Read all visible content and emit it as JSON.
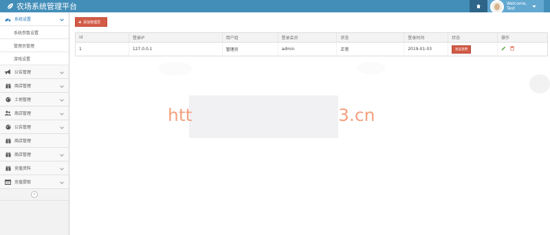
{
  "header": {
    "title": "农场系统管理平台",
    "welcome": "Welcome,",
    "username": "Test",
    "bg_color": "#438eb9"
  },
  "sidebar": {
    "items": [
      {
        "label": "系统设置",
        "icon": "dashboard-icon",
        "open": true,
        "sub": [
          {
            "label": "系统参数设置"
          },
          {
            "label": "管理员管理"
          },
          {
            "label": "游戏设置"
          }
        ]
      },
      {
        "label": "公告管理",
        "icon": "bullhorn-icon"
      },
      {
        "label": "商店管理",
        "icon": "gift-icon"
      },
      {
        "label": "土地管理",
        "icon": "globe-icon"
      },
      {
        "label": "商店管理",
        "icon": "users-icon"
      },
      {
        "label": "公告管理",
        "icon": "globe-icon"
      },
      {
        "label": "商店管理",
        "icon": "gift-icon"
      },
      {
        "label": "商店管理",
        "icon": "gift-icon"
      },
      {
        "label": "充值资料",
        "icon": "gift-icon"
      },
      {
        "label": "充值提取",
        "icon": "calendar-icon"
      }
    ],
    "collapse_glyph": "«"
  },
  "main": {
    "add_button_label": "添加管理员",
    "table": {
      "headers": [
        "id",
        "登录IP",
        "用户组",
        "登录会员",
        "状态",
        "登录时间",
        "状态",
        "操作"
      ],
      "rows": [
        {
          "id": "1",
          "ip": "127.0.0.1",
          "group": "管理员",
          "member": "admin",
          "status": "正常",
          "time": "2019-01-03",
          "action_label": "状态禁用"
        }
      ]
    }
  },
  "watermark": {
    "left": "htt",
    "right": "3.cn",
    "color": "#f4a080"
  },
  "colors": {
    "accent": "#438eb9",
    "danger": "#d15b47",
    "edit": "#69aa46",
    "trash": "#dd5a43"
  }
}
